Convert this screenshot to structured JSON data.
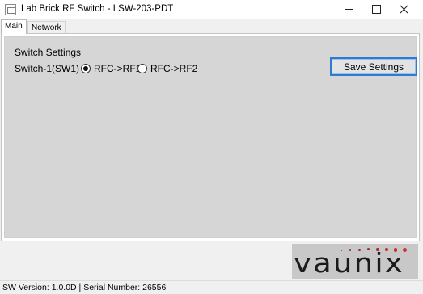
{
  "window": {
    "title": "Lab Brick RF Switch - LSW-203-PDT"
  },
  "tabs": [
    {
      "label": "Main",
      "active": true
    },
    {
      "label": "Network",
      "active": false
    }
  ],
  "main": {
    "group_title": "Switch Settings",
    "switch_label": "Switch-1(SW1)",
    "options": [
      {
        "label": "RFC->RF1",
        "checked": true
      },
      {
        "label": "RFC->RF2",
        "checked": false
      }
    ],
    "save_label": "Save Settings"
  },
  "logo": {
    "text": "vaunix",
    "dot_colors": [
      "#8a2b2b",
      "#8a2b2b",
      "#9a2a2a",
      "#a52a2a",
      "#b22a2a",
      "#c02a2a",
      "#c82c2c",
      "#d23030"
    ]
  },
  "status": {
    "version": "SW Version: 1.0.0D",
    "serial": "Serial Number: 26556"
  },
  "colors": {
    "panel": "#d6d6d6",
    "accent": "#2f7bd1",
    "logo_background": "#c8c8c8"
  }
}
